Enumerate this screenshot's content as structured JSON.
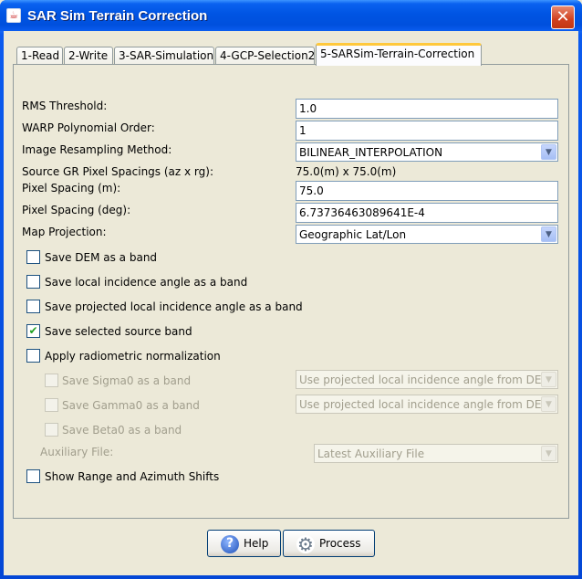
{
  "window": {
    "title": "SAR Sim Terrain Correction",
    "close_glyph": "✕"
  },
  "tabs": [
    {
      "label": "1-Read"
    },
    {
      "label": "2-Write"
    },
    {
      "label": "3-SAR-Simulation"
    },
    {
      "label": "4-GCP-Selection2"
    },
    {
      "label": "5-SARSim-Terrain-Correction",
      "active": true
    }
  ],
  "form": {
    "rms_threshold": {
      "label": "RMS Threshold:",
      "value": "1.0"
    },
    "warp_order": {
      "label": "WARP Polynomial Order:",
      "value": "1"
    },
    "resampling": {
      "label": "Image Resampling Method:",
      "value": "BILINEAR_INTERPOLATION"
    },
    "source_spacing": {
      "label": "Source GR Pixel Spacings (az x rg):",
      "value": "75.0(m) x 75.0(m)"
    },
    "pixel_spacing_m": {
      "label": "Pixel Spacing (m):",
      "value": "75.0"
    },
    "pixel_spacing_deg": {
      "label": "Pixel Spacing (deg):",
      "value": "6.73736463089641E-4"
    },
    "map_projection": {
      "label": "Map Projection:",
      "value": "Geographic Lat/Lon"
    }
  },
  "checkboxes": {
    "save_dem": {
      "label": "Save DEM as a band",
      "checked": false
    },
    "save_lia": {
      "label": "Save local incidence angle as a band",
      "checked": false
    },
    "save_plia": {
      "label": "Save projected local incidence angle as a band",
      "checked": false
    },
    "save_source": {
      "label": "Save selected source band",
      "checked": true
    },
    "radiometric": {
      "label": "Apply radiometric normalization",
      "checked": false
    },
    "sigma0": {
      "label": "Save Sigma0 as a band",
      "checked": false,
      "disabled": true
    },
    "gamma0": {
      "label": "Save Gamma0 as a band",
      "checked": false,
      "disabled": true
    },
    "beta0": {
      "label": "Save Beta0 as a band",
      "checked": false,
      "disabled": true
    },
    "shifts": {
      "label": "Show Range and Azimuth Shifts",
      "checked": false
    }
  },
  "dropdowns": {
    "sigma0_method": "Use projected local incidence angle from DEM",
    "gamma0_method": "Use projected local incidence angle from DEM",
    "aux_file_label": "Auxiliary File:",
    "aux_file": "Latest Auxiliary File"
  },
  "buttons": {
    "help": "Help",
    "process": "Process"
  },
  "check_glyph": "✔",
  "arrow_glyph": "▼",
  "icons": {
    "help": "help-icon",
    "process": "gear-icon"
  }
}
